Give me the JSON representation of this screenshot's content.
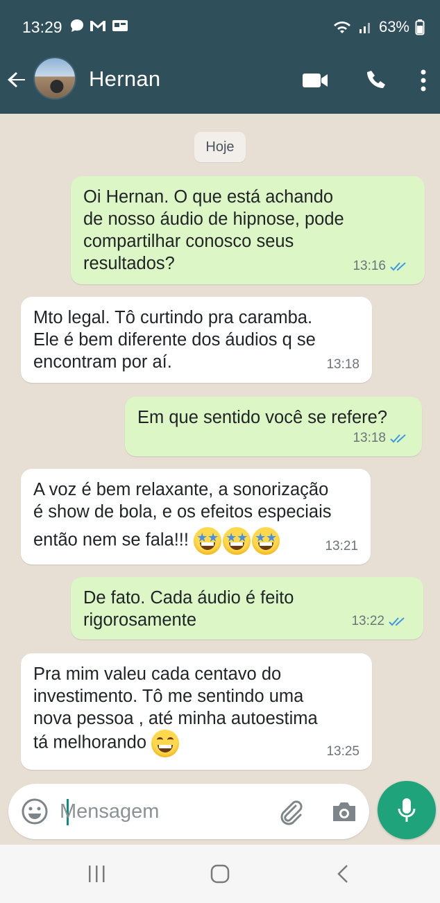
{
  "status_bar": {
    "time": "13:29",
    "left_icons": [
      "chat-bubble-icon",
      "gmail-icon",
      "screen-icon"
    ],
    "battery": "63%",
    "right_icons": [
      "wifi-icon",
      "signal-icon",
      "battery-icon"
    ]
  },
  "header": {
    "contact_name": "Hernan",
    "icons": [
      "back-arrow-icon",
      "video-call-icon",
      "phone-icon",
      "more-vert-icon"
    ]
  },
  "chat": {
    "date_label": "Hoje",
    "messages": [
      {
        "direction": "out",
        "lines": [
          "Oi Hernan. O que está achando",
          "de nosso áudio de hipnose, pode",
          "compartilhar conosco seus",
          "resultados?"
        ],
        "time": "13:16",
        "status": "read"
      },
      {
        "direction": "in",
        "lines": [
          "Mto legal. Tô curtindo pra caramba.",
          "Ele é bem diferente dos áudios q se",
          "encontram por aí."
        ],
        "time": "13:18"
      },
      {
        "direction": "out",
        "lines": [
          "Em que sentido você se refere?"
        ],
        "time": "13:18",
        "status": "read"
      },
      {
        "direction": "in",
        "lines": [
          "A voz é bem relaxante, a sonorização",
          "é show de bola, e os efeitos especiais",
          "então nem se fala!!!"
        ],
        "emojis": [
          "star-struck-emoji",
          "star-struck-emoji",
          "star-struck-emoji"
        ],
        "time": "13:21"
      },
      {
        "direction": "out",
        "lines": [
          "De fato. Cada áudio é feito",
          "rigorosamente"
        ],
        "time": "13:22",
        "status": "read"
      },
      {
        "direction": "in",
        "lines": [
          "Pra mim valeu cada centavo do",
          "investimento. Tô me sentindo uma",
          "nova pessoa , até minha autoestima",
          "tá melhorando"
        ],
        "emojis": [
          "grinning-emoji"
        ],
        "time": "13:25"
      }
    ]
  },
  "composer": {
    "placeholder": "Mensagem",
    "value": "",
    "icons": [
      "emoji-icon",
      "attach-icon",
      "camera-icon",
      "mic-icon"
    ]
  },
  "navbar": {
    "icons": [
      "recent-apps-icon",
      "home-icon",
      "back-icon"
    ]
  },
  "colors": {
    "header_bg": "#2f4f5b",
    "chat_bg": "#e7ded4",
    "outgoing_bubble": "#dcf7c5",
    "incoming_bubble": "#ffffff",
    "read_ticks": "#3a9be0",
    "mic_button": "#1fa37a"
  }
}
